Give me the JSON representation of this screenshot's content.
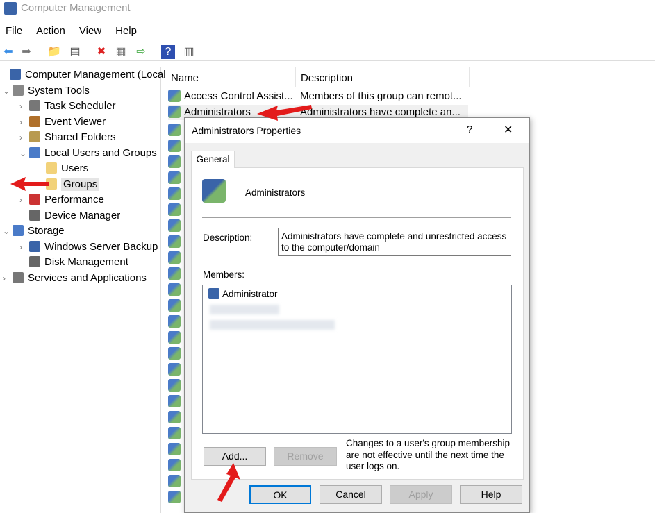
{
  "window": {
    "title": "Computer Management"
  },
  "menu": [
    "File",
    "Action",
    "View",
    "Help"
  ],
  "toolbar": [
    "back-icon",
    "forward-icon",
    "up-folder-icon",
    "show-hide-tree-icon",
    "delete-icon",
    "properties-icon",
    "export-icon",
    "help-icon",
    "action-pane-icon"
  ],
  "tree": [
    {
      "label": "Computer Management (Local",
      "level": 0,
      "chev": ""
    },
    {
      "label": "System Tools",
      "level": 0,
      "chev": "v"
    },
    {
      "label": "Task Scheduler",
      "level": 1,
      "chev": ">"
    },
    {
      "label": "Event Viewer",
      "level": 1,
      "chev": ">"
    },
    {
      "label": "Shared Folders",
      "level": 1,
      "chev": ">"
    },
    {
      "label": "Local Users and Groups",
      "level": 1,
      "chev": "v"
    },
    {
      "label": "Users",
      "level": 2,
      "chev": ""
    },
    {
      "label": "Groups",
      "level": 2,
      "chev": "",
      "selected": true
    },
    {
      "label": "Performance",
      "level": 1,
      "chev": ">"
    },
    {
      "label": "Device Manager",
      "level": 1,
      "chev": ""
    },
    {
      "label": "Storage",
      "level": 0,
      "chev": "v"
    },
    {
      "label": "Windows Server Backup",
      "level": 1,
      "chev": ">"
    },
    {
      "label": "Disk Management",
      "level": 1,
      "chev": ""
    },
    {
      "label": "Services and Applications",
      "level": 0,
      "chev": ">"
    }
  ],
  "list": {
    "columns": [
      "Name",
      "Description"
    ],
    "rows": [
      {
        "name": "Access Control Assist...",
        "desc": "Members of this group can remot..."
      },
      {
        "name": "Administrators",
        "desc": "Administrators have complete an..."
      }
    ]
  },
  "dialog": {
    "title": "Administrators Properties",
    "help": "?",
    "close": "✕",
    "tab": "General",
    "group_name": "Administrators",
    "description_label": "Description:",
    "description": "Administrators have complete and unrestricted access to the computer/domain",
    "members_label": "Members:",
    "members": [
      "Administrator"
    ],
    "note": "Changes to a user's group membership are not effective until the next time the user logs on.",
    "add": "Add...",
    "remove": "Remove",
    "ok": "OK",
    "cancel": "Cancel",
    "apply": "Apply",
    "help_btn": "Help"
  },
  "colors": {
    "arrow": "#e31b1b",
    "selected": "#e5e5e5",
    "ok_border": "#0078d7"
  }
}
